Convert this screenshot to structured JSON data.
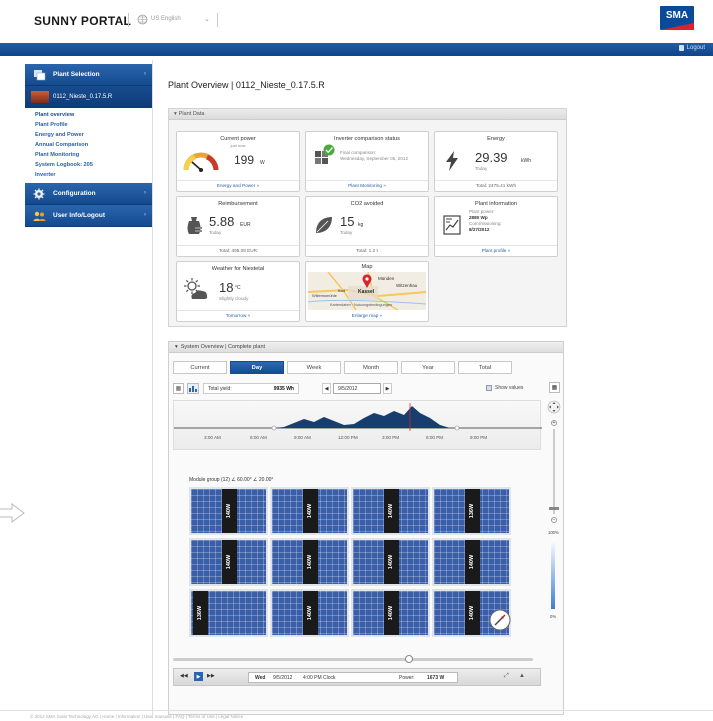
{
  "header": {
    "brand": "SUNNY PORTAL",
    "language": "US English",
    "logo_text": "SMA",
    "logout_label": "Logout"
  },
  "sidebar": {
    "plant_selection": "Plant Selection",
    "plant_name": "0112_Nieste_0.17.5.R",
    "sub_items": [
      "Plant overview",
      "Plant Profile",
      "Energy and Power",
      "Annual Comparison",
      "Plant Monitoring",
      "System Logbook: 205",
      "Inverter"
    ],
    "configuration": "Configuration",
    "user_info": "User Info/Logout"
  },
  "main": {
    "title": "Plant Overview | 0112_Nieste_0.17.5.R",
    "plant_data_header": "Plant Data",
    "tiles": {
      "current_power": {
        "title": "Current power",
        "subtitle": "just now",
        "value": "199",
        "unit": "W",
        "link": "Energy and Power »"
      },
      "inverter": {
        "title": "Inverter comparison status",
        "line1": "Final comparison:",
        "line2": "Wednesday, September 05, 2012",
        "link": "Plant Monitoring »"
      },
      "energy": {
        "title": "Energy",
        "value": "29.39",
        "unit": "kWh",
        "today": "Today",
        "total": "Total: 2475.41 kWh"
      },
      "reimbursement": {
        "title": "Reimbursement",
        "value": "5.88",
        "unit": "EUR",
        "today": "Today",
        "total": "Total: 495.08 EUR"
      },
      "co2": {
        "title": "CO2 avoided",
        "value": "15",
        "unit": "kg",
        "today": "Today",
        "total": "Total: 1.2 t"
      },
      "plant_info": {
        "title": "Plant information",
        "line1": "Plant power:",
        "line2": "2880 Wp",
        "line3": "Commissioning:",
        "line4": "8/27/2012",
        "link": "Plant profile »"
      },
      "weather": {
        "title": "Weather for Niestetal",
        "value": "18",
        "unit": "°C",
        "desc": "Slightly cloudy",
        "link": "Tomorrow »"
      },
      "map": {
        "title": "Map",
        "place1": "Münden",
        "place2": "Witzenhau",
        "place3": "Kassel",
        "place4": "Willemsmühle",
        "place5": "Bad",
        "credits": "Kartendaten · Nutzungsbedingungen",
        "link": "Enlarge map »"
      }
    }
  },
  "system": {
    "header": "System Overview  |  Complete plant",
    "tabs": [
      "Current",
      "Day",
      "Week",
      "Month",
      "Year",
      "Total"
    ],
    "active_tab": "Day",
    "total_yield_label": "Total yield:",
    "total_yield_value": "9935 Wh",
    "date": "9/5/2012",
    "show_values": "Show values",
    "time_ticks": [
      "3:00 AM",
      "6:00 AM",
      "9:00 AM",
      "12:00 PM",
      "3:00 PM",
      "6:00 PM",
      "9:00 PM"
    ],
    "module_group": "Module group (12) ∠ 60.00° ∠ 20.00°",
    "panels": [
      "140W",
      "140W",
      "140W",
      "136W",
      "140W",
      "140W",
      "140W",
      "140W",
      "136W",
      "140W",
      "140W",
      "140W"
    ],
    "zoom_pct_top": "100%",
    "zoom_pct_bottom": "0%",
    "bottom": {
      "day": "Wed",
      "date": "9/5/2012",
      "time": "4:00 PM Clock",
      "power_label": "Power:",
      "power_value": "1673 W"
    }
  },
  "footer": {
    "text": "© 2012 SMA Solar Technology AG  |  Home  |  Information  |  User manuals  |  FAQ  |  Terms of Use  |  Legal Notice"
  },
  "colors": {
    "brand_blue": "#154a8e",
    "accent_red": "#d4262e",
    "link_blue": "#2a5fa8"
  }
}
